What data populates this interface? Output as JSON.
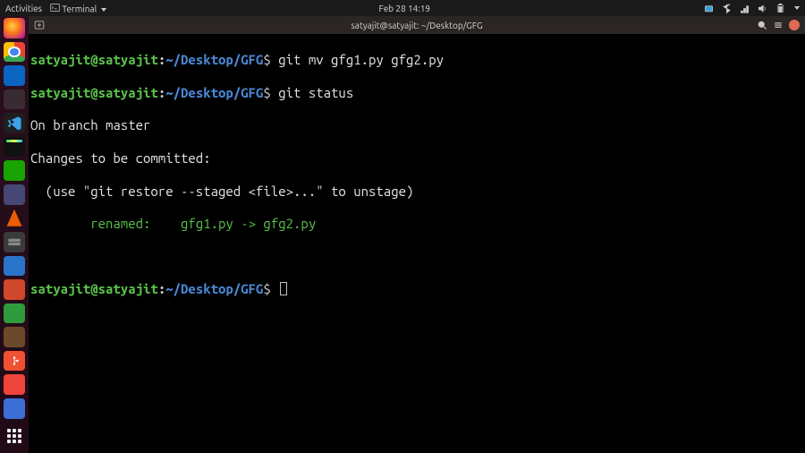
{
  "topbar": {
    "activities": "Activities",
    "app_menu": "Terminal",
    "clock": "Feb 28  14:19"
  },
  "window": {
    "title": "satyajit@satyajit: ~/Desktop/GFG",
    "new_tab_tooltip": "New Tab"
  },
  "dock": {
    "items": [
      "firefox",
      "chrome",
      "outlook",
      "rect",
      "vscode",
      "pycharm",
      "libre1",
      "teams",
      "vlc",
      "folder",
      "writer",
      "impress",
      "calc",
      "drawer",
      "git",
      "anydesk",
      "todo"
    ]
  },
  "prompt": {
    "user": "satyajit@satyajit",
    "sep": ":",
    "path": "~/Desktop/GFG",
    "sigil": "$"
  },
  "session": {
    "cmd1": "git mv gfg1.py gfg2.py",
    "cmd2": "git status",
    "out_branch": "On branch master",
    "out_changes_header": "Changes to be committed:",
    "out_hint": "  (use \"git restore --staged <file>...\" to unstage)",
    "out_renamed_label": "        renamed:    ",
    "out_renamed_files": "gfg1.py -> gfg2.py"
  }
}
